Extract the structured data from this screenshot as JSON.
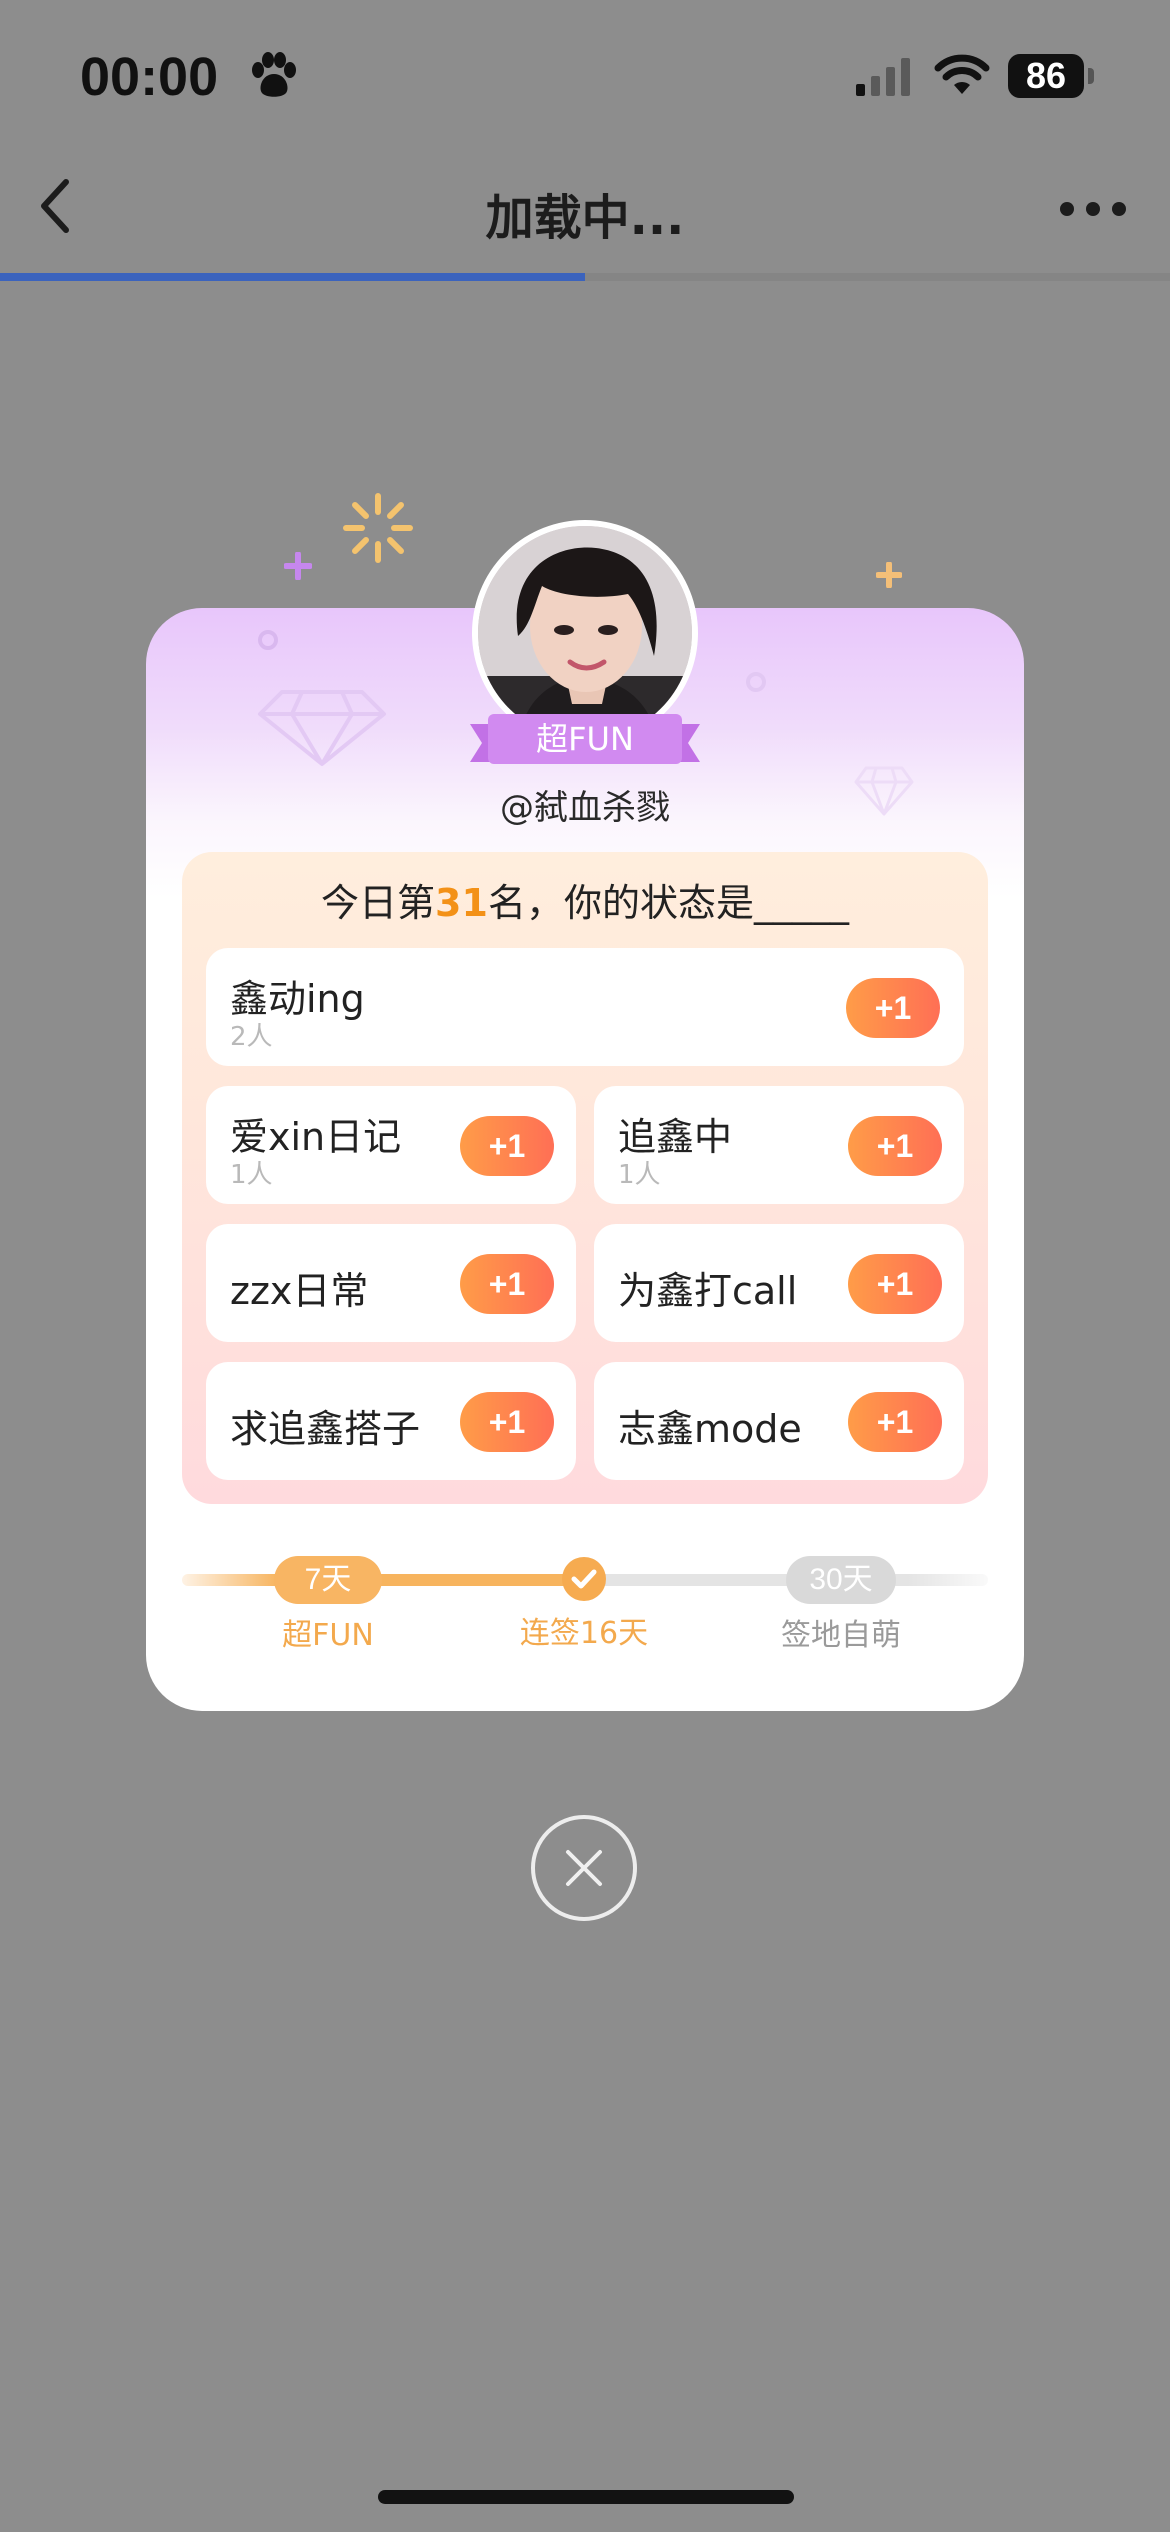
{
  "status_bar": {
    "time": "00:00",
    "battery": "86",
    "icons": [
      "paw-icon",
      "signal-icon",
      "wifi-icon",
      "battery-icon"
    ]
  },
  "nav": {
    "title": "加载中...",
    "progress": 0.5,
    "back_icon": "chevron-left-icon",
    "more_icon": "more-icon"
  },
  "card": {
    "badge": "超FUN",
    "username": "@弑血杀戮",
    "prompt_prefix": "今日第",
    "rank": "31",
    "prompt_suffix": "名，你的状态是_____",
    "plus_label": "+1",
    "items": [
      {
        "label": "鑫动ing",
        "count": "2人"
      },
      {
        "label": "爱xin日记",
        "count": "1人"
      },
      {
        "label": "追鑫中",
        "count": "1人"
      },
      {
        "label": "zzx日常"
      },
      {
        "label": "为鑫打call"
      },
      {
        "label": "求追鑫搭子"
      },
      {
        "label": "志鑫mode"
      }
    ],
    "streak": {
      "milestones": [
        {
          "pill": "7天",
          "label": "超FUN"
        },
        {
          "label": "连签16天"
        },
        {
          "pill": "30天",
          "label": "签地自萌"
        }
      ]
    }
  },
  "colors": {
    "accent_orange": "#f39117",
    "button_gradient": [
      "#ff9c48",
      "#ff6f55"
    ],
    "badge_purple": "#cc86ef",
    "progress_blue": "#3b63bd"
  }
}
